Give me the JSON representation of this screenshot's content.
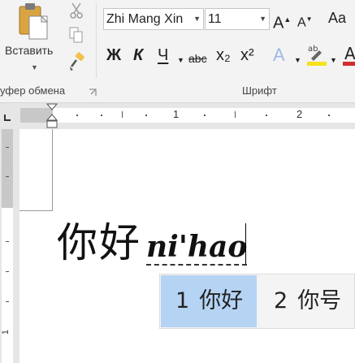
{
  "ribbon": {
    "clipboard": {
      "paste_label": "Вставить",
      "group_label": "уфер обмена"
    },
    "font": {
      "font_name": "Zhi Mang Xin",
      "font_size": "11",
      "grow_label": "A",
      "shrink_label": "A",
      "case_label": "Aa",
      "bold_label": "Ж",
      "italic_label": "К",
      "underline_label": "Ч",
      "strike_label": "abc",
      "subscript_label": "x₂",
      "superscript_label": "x²",
      "effects_label": "A",
      "group_label": "Шрифт",
      "highlight_color": "#f5e21b",
      "font_color": "#d22d2d"
    }
  },
  "ruler": {
    "numbers": [
      "1",
      "2"
    ],
    "vertical_number": "1"
  },
  "document": {
    "hanzi": "你好",
    "pinyin": "ni'hao"
  },
  "ime": {
    "candidates": [
      {
        "index": "1",
        "text": "你好",
        "selected": true
      },
      {
        "index": "2",
        "text": "你号",
        "selected": false
      }
    ],
    "selected_color": "#b5d3f3"
  }
}
